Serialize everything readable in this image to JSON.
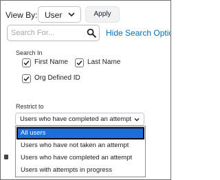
{
  "toolbar": {
    "view_by_label": "View By:",
    "view_by_value": "User",
    "apply_label": "Apply"
  },
  "search": {
    "placeholder": "Search For...",
    "value": "",
    "hide_options_label": "Hide Search Options"
  },
  "search_in": {
    "label": "Search In",
    "options": [
      {
        "label": "First Name",
        "checked": true
      },
      {
        "label": "Last Name",
        "checked": true
      },
      {
        "label": "Org Defined ID",
        "checked": true
      }
    ]
  },
  "restrict_to": {
    "label": "Restrict to",
    "selected_value": "Users who have completed an attempt",
    "options": [
      {
        "label": "All users",
        "highlighted": true
      },
      {
        "label": "Users who have not taken an attempt",
        "highlighted": false
      },
      {
        "label": "Users who have completed an attempt",
        "highlighted": false
      },
      {
        "label": "Users with attempts in progress",
        "highlighted": false
      }
    ]
  },
  "colors": {
    "link": "#006fbf",
    "highlight": "#1c6edc",
    "border": "#c2c3c6"
  },
  "icons": {
    "view_by_chevron": "chevron-down-icon",
    "search": "search-icon",
    "checkbox_check": "check-icon",
    "restrict_chevron": "chevron-down-icon"
  }
}
